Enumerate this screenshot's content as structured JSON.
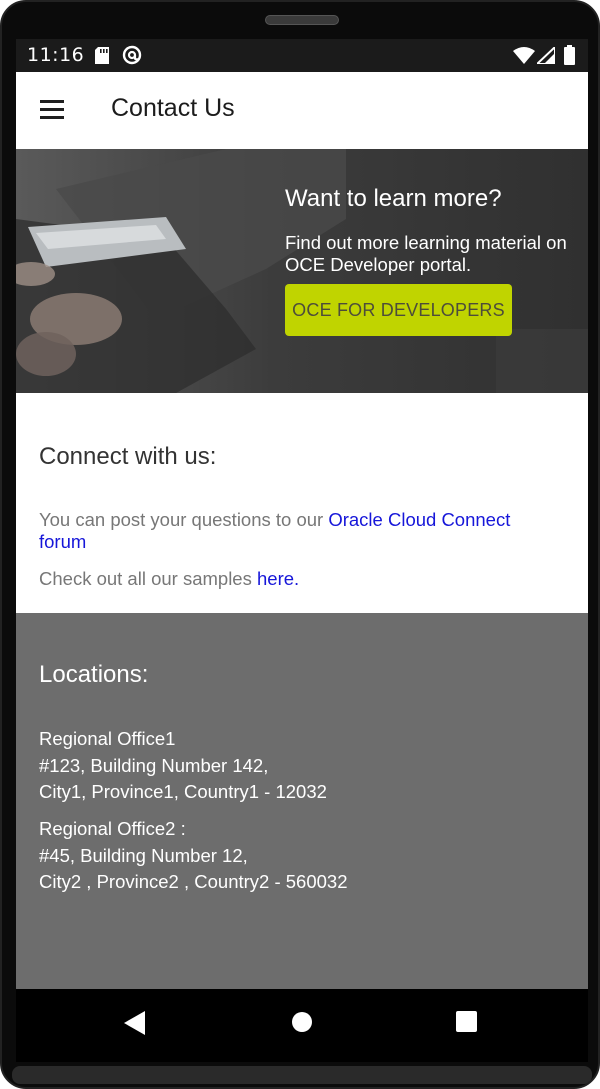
{
  "status_bar": {
    "time": "11:16"
  },
  "app_bar": {
    "title": "Contact Us",
    "menu_icon": "hamburger-menu-icon"
  },
  "hero": {
    "title": "Want to learn more?",
    "text": "Find out more learning material on OCE Developer portal.",
    "button_label": "OCE FOR DEVELOPERS",
    "button_color": "#c0d400"
  },
  "connect": {
    "title": "Connect with us:",
    "line1_prefix": "You can post your questions to our ",
    "line1_link": "Oracle Cloud Connect forum",
    "line2_prefix": "Check out all our samples ",
    "line2_link": "here.",
    "link_color": "#1616d9"
  },
  "locations": {
    "title": "Locations:",
    "offices": [
      {
        "name": "Regional Office1",
        "address1": "#123, Building Number 142,",
        "address2": "City1, Province1, Country1 - 12032"
      },
      {
        "name": "Regional Office2 :",
        "address1": "#45, Building Number 12,",
        "address2": "City2 , Province2 , Country2 - 560032"
      }
    ],
    "background": "#6d6d6d"
  },
  "nav_bar": {
    "back": "back-icon",
    "home": "home-icon",
    "recents": "recents-icon"
  }
}
